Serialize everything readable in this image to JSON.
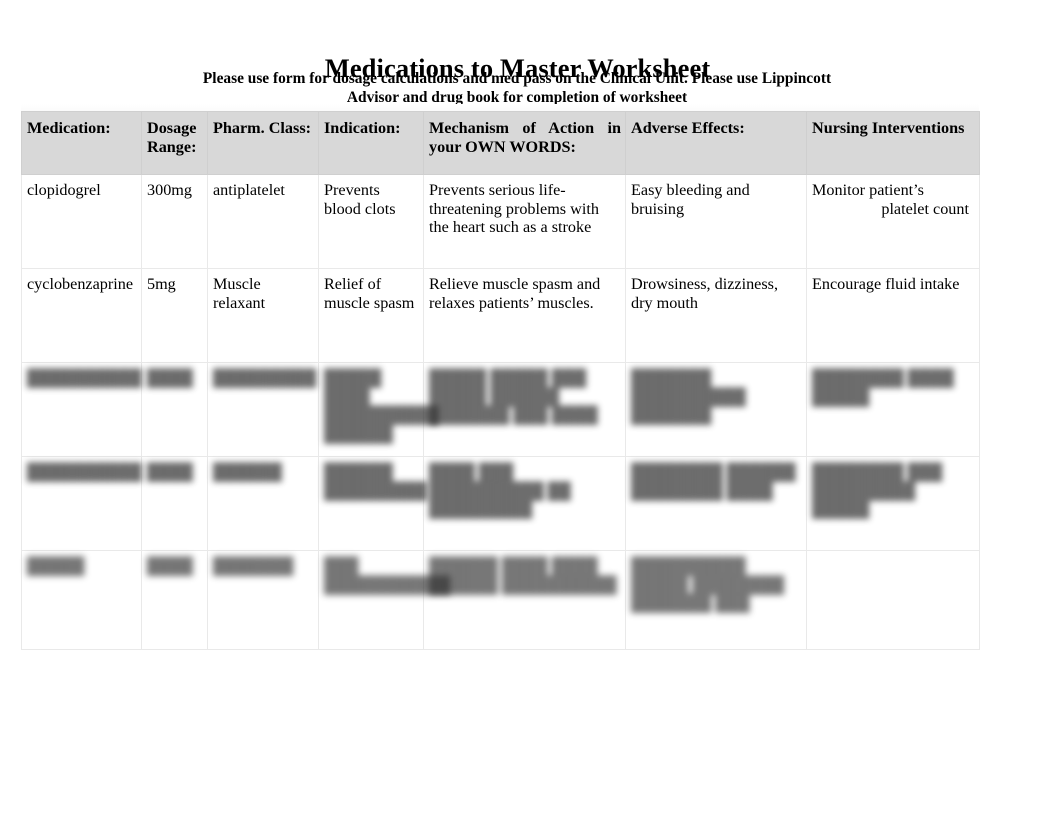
{
  "document": {
    "title": "Medications to Master Worksheet",
    "subtitle": "Please use form for dosage calculations and med pass on the Clinical Unit. Please use Lippincott Advisor and drug book for completion of worksheet",
    "subtitle_line1": "Please use form for dosage calculations and med pass on the Clinical Unit. Please use",
    "subtitle_line2": "Lippincott Advisor and drug book for completion of worksheet"
  },
  "table": {
    "headers": {
      "medication": "Medication:",
      "dosage_range_line1": "Dosage",
      "dosage_range_line2": "Range:",
      "pharm_class": "Pharm. Class:",
      "indication": "Indication:",
      "mechanism_line1": "Mechanism of Action in",
      "mechanism_line2": "your OWN WORDS:",
      "adverse_effects": "Adverse Effects:",
      "nursing_interventions": "Nursing Interventions"
    },
    "rows": [
      {
        "redacted": false,
        "medication": "clopidogrel",
        "dosage_range": "300mg",
        "pharm_class": "antiplatelet",
        "indication": "Prevents blood clots",
        "mechanism": "Prevents serious life-threatening problems with the heart such as a stroke",
        "adverse_effects": "Easy bleeding and bruising",
        "nursing_first": "Monitor patient’s",
        "nursing_rest": "platelet count"
      },
      {
        "redacted": false,
        "medication": "cyclobenzaprine",
        "dosage_range": "5mg",
        "pharm_class": "Muscle relaxant",
        "indication": "Relief of muscle spasm",
        "mechanism": "Relieve muscle spasm and relaxes patients’ muscles.",
        "adverse_effects": "Drowsiness, dizziness, dry mouth",
        "nursing_first": "Encourage fluid intake",
        "nursing_rest": ""
      },
      {
        "redacted": true,
        "medication": "██████████",
        "dosage_range": "████",
        "pharm_class": "█████████",
        "indication": "█████ ████ ██████████ ██████",
        "mechanism": "█████ █████ ███ █████ ██████ ███████ ███ ████",
        "adverse_effects": "███████ ██████████ ███████",
        "nursing_first": "████████ ████ █████",
        "nursing_rest": ""
      },
      {
        "redacted": true,
        "medication": "██████████",
        "dosage_range": "████",
        "pharm_class": "██████",
        "indication": "██████ █████████",
        "mechanism": "████ ███ ██████████ ██ █████████",
        "adverse_effects": "████████ ██████ ████████ ████",
        "nursing_first": "████████ ███ █████████ █████",
        "nursing_rest": ""
      },
      {
        "redacted": true,
        "medication": "█████",
        "dosage_range": "████",
        "pharm_class": "███████",
        "indication": "███ ███████████",
        "mechanism": "██████ ████ ████ ██████ ██████████",
        "adverse_effects": "██████████ █████ ████████ ███████ ███",
        "nursing_first": "",
        "nursing_rest": ""
      }
    ]
  },
  "colors": {
    "page_background": "#ffffff",
    "header_row_background": "#d8d8d8",
    "text": "#000000",
    "cell_border": "#e9e9e9"
  }
}
